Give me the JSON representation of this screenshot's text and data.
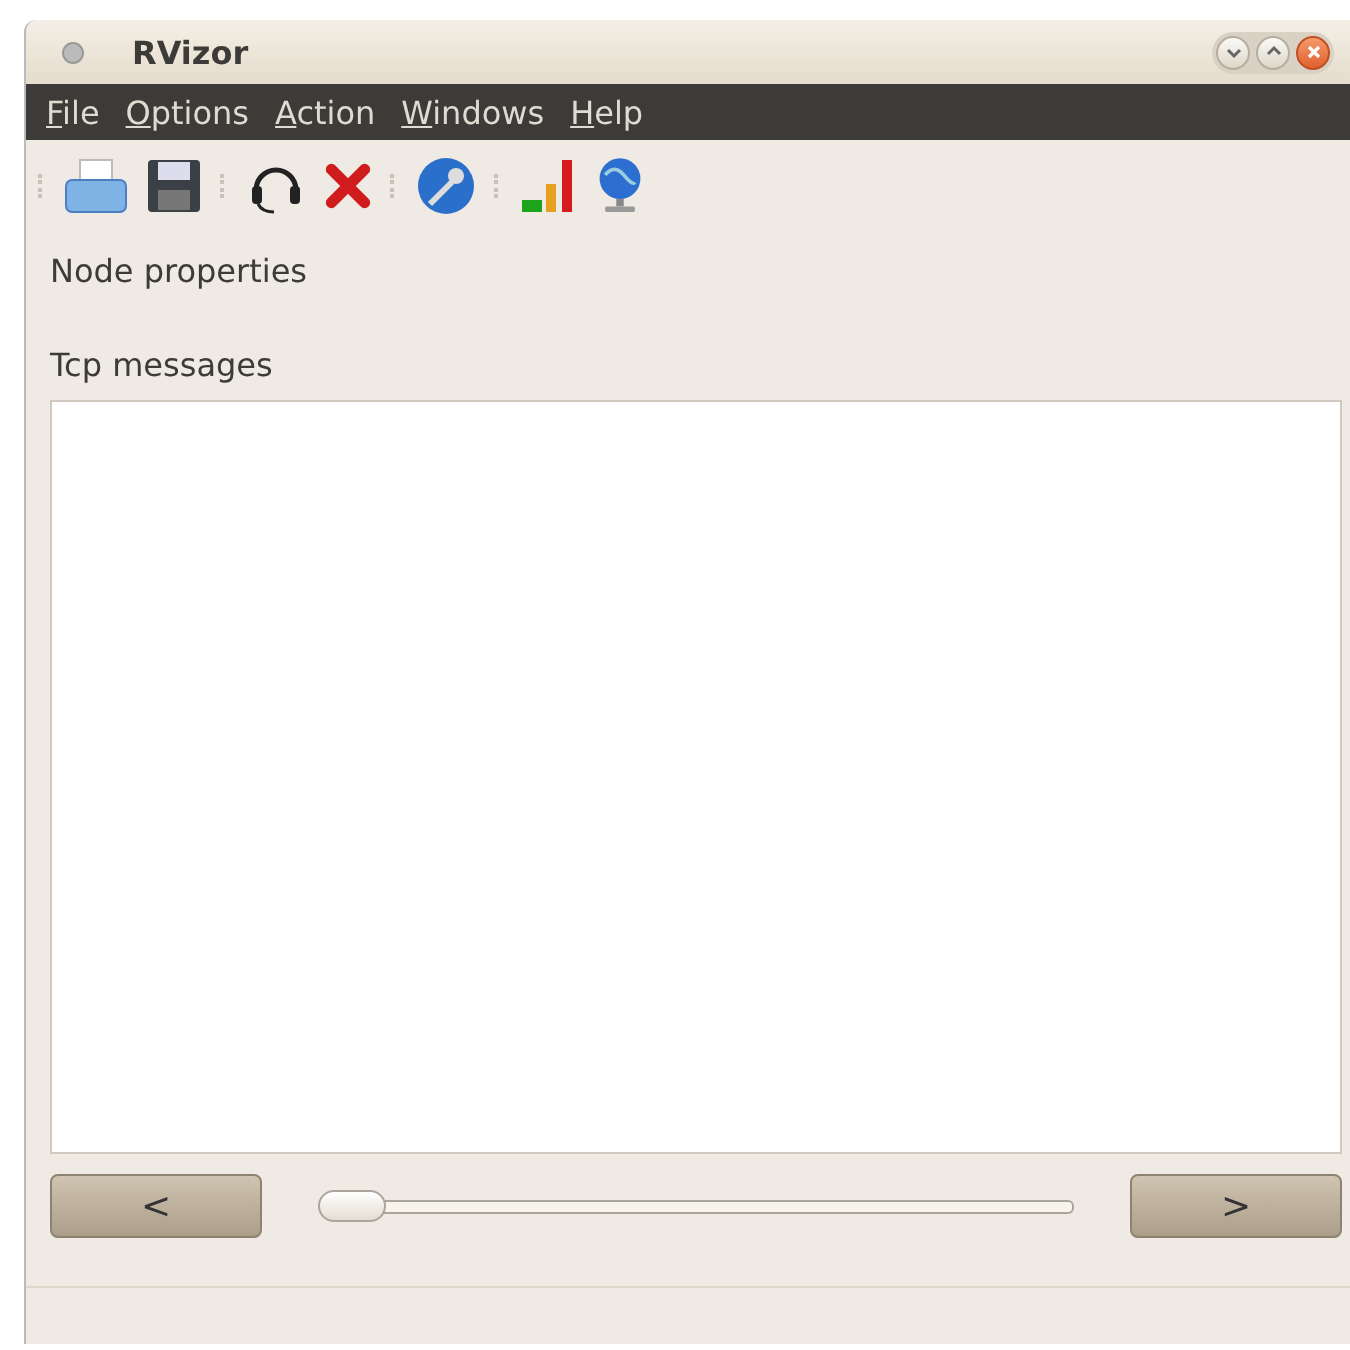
{
  "window": {
    "title": "RVizor"
  },
  "menu": [
    "File",
    "Options",
    "Action",
    "Windows",
    "Help"
  ],
  "sections": [
    {
      "label": "Node properties"
    },
    {
      "label": "Tcp messages"
    }
  ],
  "nav": {
    "prev": "<",
    "next": ">"
  },
  "slider": {
    "level": 0
  }
}
